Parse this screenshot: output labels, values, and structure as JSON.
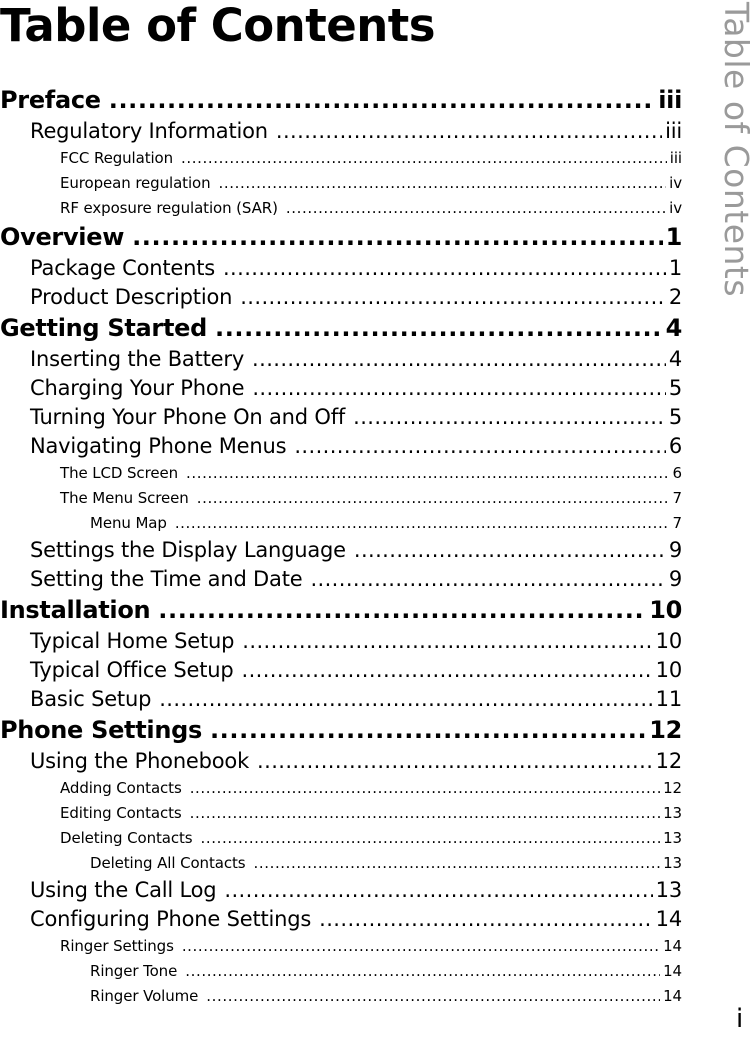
{
  "header": {
    "title": "Table of Contents"
  },
  "side_tab": {
    "title": "Table of Contents"
  },
  "footer": {
    "page_number": "i"
  },
  "toc": [
    {
      "level": 1,
      "title": "Preface",
      "page": "iii"
    },
    {
      "level": 2,
      "title": "Regulatory Information",
      "page": "iii"
    },
    {
      "level": 3,
      "title": "FCC Regulation",
      "page": "iii"
    },
    {
      "level": 3,
      "title": "European regulation",
      "page": "iv"
    },
    {
      "level": 3,
      "title": "RF exposure regulation (SAR)",
      "page": "iv"
    },
    {
      "level": 1,
      "title": "Overview",
      "page": "1"
    },
    {
      "level": 2,
      "title": "Package Contents",
      "page": "1"
    },
    {
      "level": 2,
      "title": "Product Description",
      "page": "2"
    },
    {
      "level": 1,
      "title": "Getting Started",
      "page": "4"
    },
    {
      "level": 2,
      "title": "Inserting the Battery",
      "page": "4"
    },
    {
      "level": 2,
      "title": "Charging Your Phone",
      "page": "5"
    },
    {
      "level": 2,
      "title": "Turning Your Phone On and Off",
      "page": "5"
    },
    {
      "level": 2,
      "title": "Navigating Phone Menus",
      "page": "6"
    },
    {
      "level": 3,
      "title": "The LCD Screen",
      "page": "6"
    },
    {
      "level": 3,
      "title": "The Menu Screen",
      "page": "7"
    },
    {
      "level": 4,
      "title": "Menu Map",
      "page": "7"
    },
    {
      "level": 2,
      "title": "Settings the Display Language",
      "page": "9"
    },
    {
      "level": 2,
      "title": "Setting the Time and Date",
      "page": "9"
    },
    {
      "level": 1,
      "title": "Installation",
      "page": "10"
    },
    {
      "level": 2,
      "title": "Typical Home Setup",
      "page": "10"
    },
    {
      "level": 2,
      "title": "Typical Office Setup",
      "page": "10"
    },
    {
      "level": 2,
      "title": "Basic Setup",
      "page": "11"
    },
    {
      "level": 1,
      "title": "Phone Settings",
      "page": "12"
    },
    {
      "level": 2,
      "title": "Using the Phonebook",
      "page": "12"
    },
    {
      "level": 3,
      "title": "Adding Contacts",
      "page": "12"
    },
    {
      "level": 3,
      "title": "Editing Contacts",
      "page": "13"
    },
    {
      "level": 3,
      "title": "Deleting Contacts",
      "page": "13"
    },
    {
      "level": 4,
      "title": "Deleting All Contacts",
      "page": "13"
    },
    {
      "level": 2,
      "title": "Using the Call Log",
      "page": "13"
    },
    {
      "level": 2,
      "title": "Configuring Phone Settings",
      "page": "14"
    },
    {
      "level": 3,
      "title": "Ringer Settings",
      "page": "14"
    },
    {
      "level": 4,
      "title": "Ringer Tone",
      "page": "14"
    },
    {
      "level": 4,
      "title": "Ringer Volume",
      "page": "14"
    }
  ]
}
